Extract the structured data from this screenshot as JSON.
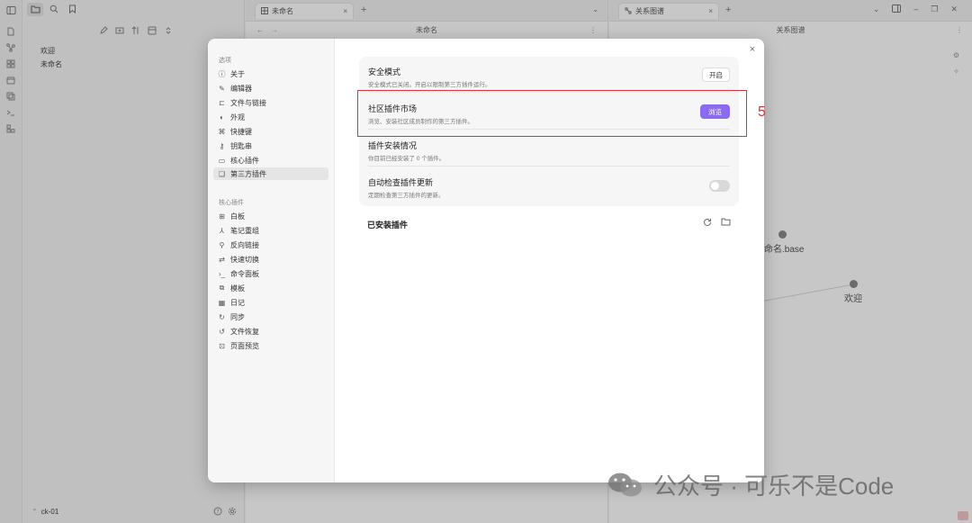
{
  "explorer": {
    "files": [
      "欢迎",
      "未命名"
    ],
    "vault_name": "ck-01"
  },
  "editor_pane": {
    "tab_label": "未命名",
    "title": "未命名"
  },
  "graph_pane": {
    "tab_label": "关系图谱",
    "title": "关系图谱",
    "nodes": [
      {
        "label": "未命名.base"
      },
      {
        "label": "欢迎"
      }
    ]
  },
  "settings": {
    "sections": [
      {
        "heading": "选项",
        "items": [
          "关于",
          "编辑器",
          "文件与链接",
          "外观",
          "快捷键",
          "钥匙串",
          "核心插件",
          "第三方插件"
        ]
      },
      {
        "heading": "核心插件",
        "items": [
          "白板",
          "笔记重组",
          "反向链接",
          "快速切换",
          "命令面板",
          "模板",
          "日记",
          "同步",
          "文件恢复",
          "页面预览"
        ]
      }
    ],
    "active_item": "第三方插件",
    "close_symbol": "×",
    "rows": [
      {
        "title": "安全模式",
        "desc": "安全模式已关闭。开启以限制第三方插件运行。",
        "button": "开启"
      },
      {
        "title": "社区插件市场",
        "desc": "浏览、安装社区成员制作的第三方插件。",
        "button": "浏览"
      },
      {
        "title": "插件安装情况",
        "desc": "你目前已经安装了 0 个插件。"
      },
      {
        "title": "自动检查插件更新",
        "desc": "定期检查第三方插件的更新。",
        "toggle_on": false
      }
    ],
    "installed_heading": "已安装插件"
  },
  "annotation": {
    "step": "5",
    "color": "#d9333b"
  },
  "watermark": {
    "text": "公众号 · 可乐不是Code"
  },
  "colors": {
    "accent": "#8b6cf0"
  }
}
